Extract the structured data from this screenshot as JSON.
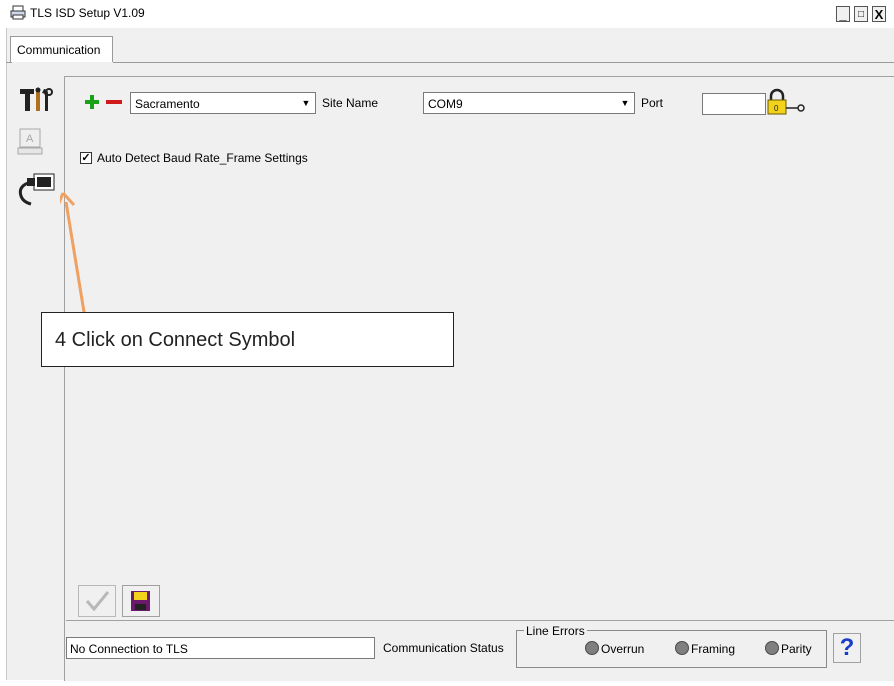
{
  "window": {
    "title": "TLS ISD Setup V1.09",
    "controls": [
      "_",
      "□",
      "X"
    ]
  },
  "tabs": [
    {
      "label": "Communication",
      "active": true
    }
  ],
  "sidebar": {
    "items": [
      {
        "name": "tools",
        "icon": "tools-icon"
      },
      {
        "name": "display",
        "icon": "monitor-icon"
      },
      {
        "name": "connect",
        "icon": "connect-cable-icon"
      }
    ]
  },
  "site": {
    "add_icon": "plus-icon",
    "remove_icon": "minus-icon",
    "value": "Sacramento",
    "label": "Site Name"
  },
  "port": {
    "value": "COM9",
    "label": "Port",
    "lock_icon": "lock-key-icon"
  },
  "auto_detect": {
    "checked": true,
    "label": "Auto Detect Baud Rate_Frame Settings"
  },
  "callout": {
    "text": "4 Click on Connect Symbol",
    "arrow_color": "#f0a060"
  },
  "actions": {
    "apply_icon": "checkmark-icon",
    "save_icon": "save-disk-icon"
  },
  "status": {
    "value": "No Connection to TLS",
    "label": "Communication Status"
  },
  "line_errors": {
    "legend": "Line Errors",
    "items": [
      "Overrun",
      "Framing",
      "Parity"
    ]
  },
  "help": {
    "icon": "help-icon",
    "label": "?"
  }
}
